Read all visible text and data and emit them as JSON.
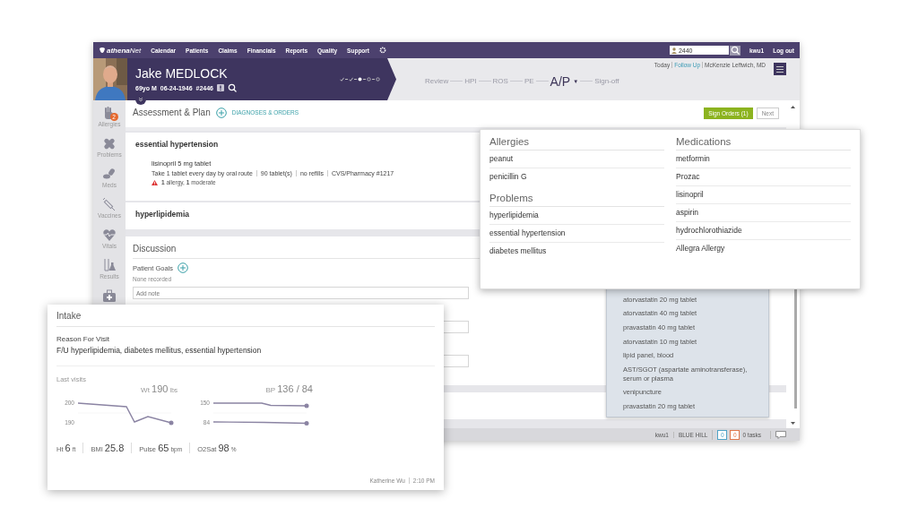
{
  "nav": {
    "logo": "**athena**Net",
    "items": [
      "Calendar",
      "Patients",
      "Claims",
      "Financials",
      "Reports",
      "Quality",
      "Support"
    ],
    "search": {
      "value": "2440"
    },
    "user": "kwu1",
    "logout": "Log out"
  },
  "patient": {
    "name": "Jake MEDLOCK",
    "age_sex": "69yo M",
    "dob": "06-24-1946",
    "id": "#2446",
    "steps": [
      {
        "completed": true,
        "current": false
      },
      {
        "completed": true,
        "current": false
      },
      {
        "completed": false,
        "current": true
      },
      {
        "completed": false,
        "current": false
      },
      {
        "completed": false,
        "current": false
      }
    ]
  },
  "workflow_tabs": [
    {
      "label": "Review",
      "selected": false
    },
    {
      "label": "HPI",
      "selected": false
    },
    {
      "label": "ROS",
      "selected": false
    },
    {
      "label": "PE",
      "selected": false
    },
    {
      "label": "A/P",
      "selected": true,
      "caret": "▼"
    },
    {
      "label": "Sign-off",
      "selected": false
    }
  ],
  "encounter": [
    {
      "label": "Today",
      "kind": "text"
    },
    {
      "label": "Follow Up",
      "kind": "link"
    },
    {
      "label": "McKenzie Leftwich, MD",
      "kind": "text"
    }
  ],
  "sidebar": {
    "items": [
      {
        "label": "Allergies",
        "kind": "hand",
        "badge": "2"
      },
      {
        "label": "Problems",
        "kind": "bandage"
      },
      {
        "label": "Meds",
        "kind": "pills"
      },
      {
        "label": "Vaccines",
        "kind": "syringe"
      },
      {
        "label": "Vitals",
        "kind": "heart"
      },
      {
        "label": "Results",
        "kind": "flask"
      },
      {
        "kind": "medkit"
      }
    ]
  },
  "assessment": {
    "title": "Assessment & Plan",
    "add_link": "DIAGNOSES & ORDERS",
    "sign_button": "Sign Orders (1)",
    "next_button": "Next",
    "diagnoses": [
      {
        "name": "essential hypertension",
        "orders": [
          {
            "name": "lisinopril 5 mg tablet",
            "details": [
              "Take 1 tablet every day by oral route",
              "90 tablet(s)",
              "no refills",
              "CVS/Pharmacy #1217"
            ],
            "warning": "**1** allergy, **1** moderate"
          }
        ]
      },
      {
        "name": "hyperlipidemia"
      }
    ]
  },
  "discussion": {
    "title": "Discussion",
    "goals_label": "Patient Goals",
    "goals_value": "None recorded",
    "note_placeholder": "Add note"
  },
  "status_bar": {
    "user": "kwu1",
    "location": "BLUE HILL",
    "counters": [
      {
        "value": "0",
        "color": "#4fa3c7"
      },
      {
        "value": "0",
        "color": "#e0764a"
      }
    ],
    "tasks": "0 tasks"
  },
  "summary_popover": {
    "columns": [
      [
        {
          "title": "Allergies",
          "items": [
            "peanut",
            "penicillin G"
          ]
        },
        {
          "title": "Problems",
          "items": [
            "hyperlipidemia",
            "essential hypertension",
            "diabetes mellitus"
          ]
        }
      ],
      [
        {
          "title": "Medications",
          "items": [
            "metformin",
            "Prozac",
            "lisinopril",
            "aspirin",
            "hydrochlorothiazide",
            "Allegra Allergy"
          ]
        }
      ]
    ]
  },
  "order_suggestions": {
    "items": [
      "atorvastatin 20 mg tablet",
      "atorvastatin 40 mg tablet",
      "pravastatin 40 mg tablet",
      "atorvastatin 10 mg tablet",
      "lipid panel, blood",
      "AST/SGOT (aspartate aminotransferase), serum or plasma",
      "venipuncture",
      "pravastatin 20 mg tablet"
    ]
  },
  "intake": {
    "title": "Intake",
    "reason_label": "Reason For Visit",
    "reason": "F/U hyperlipidemia, diabetes mellitus, essential hypertension",
    "last_visits_label": "Last visits",
    "charts": [
      {
        "kind": "weight",
        "label": "Wt",
        "value": "190",
        "unit": "lbs",
        "tick_labels": [
          "200",
          "190"
        ]
      },
      {
        "kind": "blood_pressure",
        "label": "BP",
        "value": "136 / 84",
        "tick_labels": [
          "150",
          "84"
        ]
      }
    ],
    "vitals": [
      {
        "label": "Ht",
        "value": "6",
        "unit": "ft"
      },
      {
        "label": "BMI",
        "value": "25.8"
      },
      {
        "label": "Pulse",
        "value": "65",
        "unit": "bpm"
      },
      {
        "label": "O2Sat",
        "value": "98",
        "unit": "%"
      }
    ],
    "author": "Katherine Wu",
    "time": "2:10 PM"
  }
}
